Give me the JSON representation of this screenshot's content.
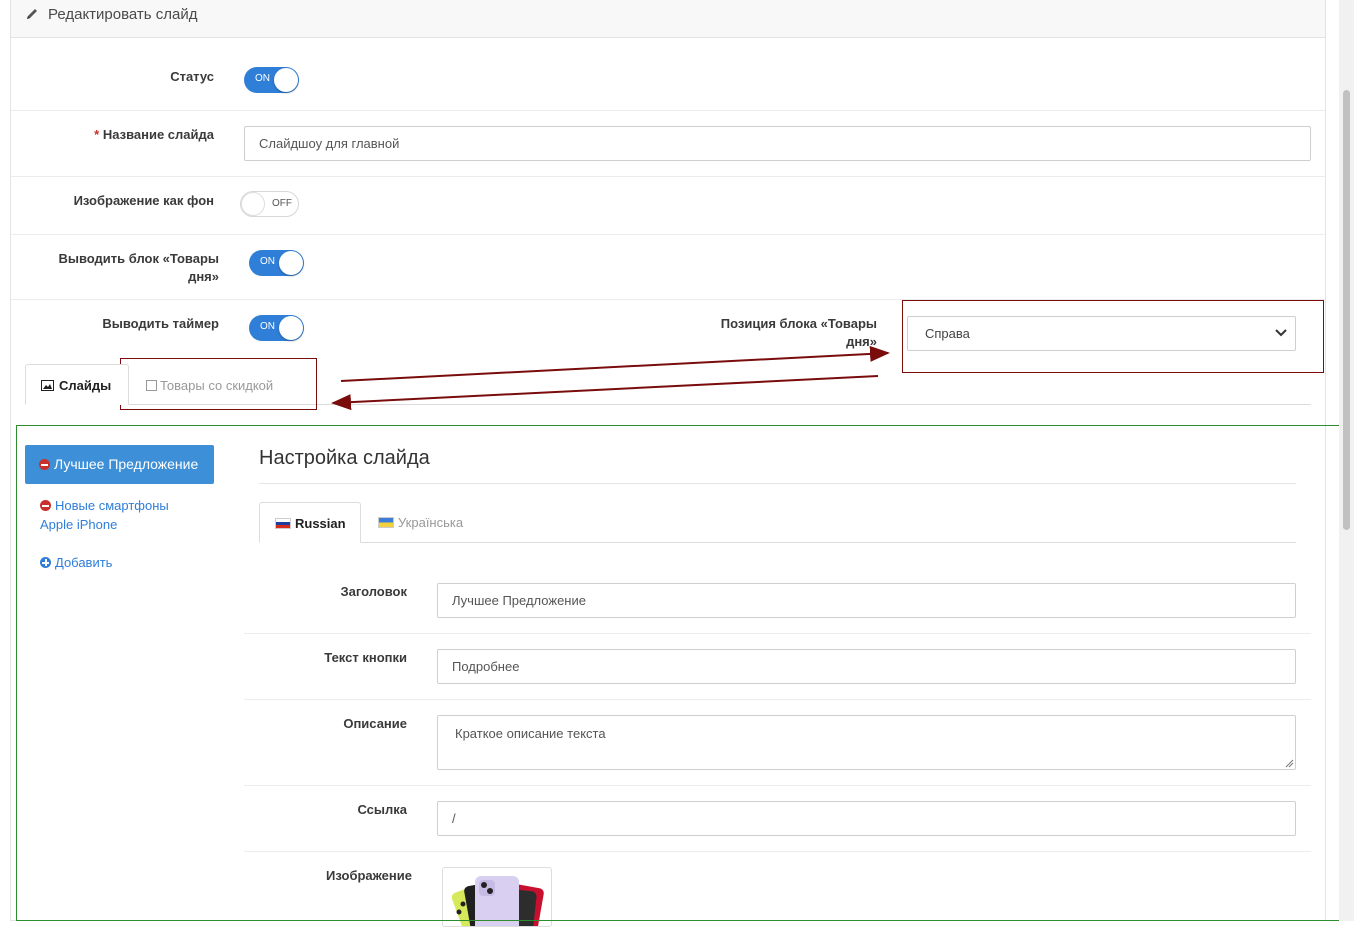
{
  "panel": {
    "title": "Редактировать слайд"
  },
  "form": {
    "status": {
      "label": "Статус",
      "state": "ON"
    },
    "slide_name": {
      "label": "Название слайда",
      "required_mark": "*",
      "value": "Слайдшоу для главной"
    },
    "image_as_bg": {
      "label": "Изображение как фон",
      "state": "OFF"
    },
    "show_products_block": {
      "label_line1": "Выводить блок «Товары",
      "label_line2": "дня»",
      "state": "ON"
    },
    "show_timer": {
      "label": "Выводить таймер",
      "state": "ON"
    },
    "block_position": {
      "label_line1": "Позиция блока «Товары",
      "label_line2": "дня»",
      "selected": "Справа"
    }
  },
  "tabs": [
    {
      "label": "Слайды",
      "active": true,
      "icon": "image-icon"
    },
    {
      "label": "Товары со скидкой",
      "active": false,
      "icon": "square-icon"
    }
  ],
  "slides_sidebar": {
    "items": [
      {
        "label": "Лучшее Предложение",
        "active": true
      },
      {
        "label_line1": "Новые смартфоны",
        "label_line2": "Apple iPhone",
        "active": false
      }
    ],
    "add_label": "Добавить"
  },
  "slide_settings": {
    "title": "Настройка слайда",
    "languages": [
      {
        "label": "Russian",
        "active": true,
        "flag": "flag-ru-icon"
      },
      {
        "label": "Українська",
        "active": false,
        "flag": "flag-ua-icon"
      }
    ],
    "fields": {
      "heading": {
        "label": "Заголовок",
        "value": "Лучшее Предложение"
      },
      "button_text": {
        "label": "Текст кнопки",
        "value": "Подробнее"
      },
      "description": {
        "label": "Описание",
        "value": "Краткое описание текста"
      },
      "link": {
        "label": "Ссылка",
        "value": "/"
      },
      "image": {
        "label": "Изображение"
      }
    }
  },
  "annotation_colors": {
    "red_frame": "#7a0c0c",
    "green_frame": "#2e8b2e",
    "accent": "#2f7ed8"
  }
}
